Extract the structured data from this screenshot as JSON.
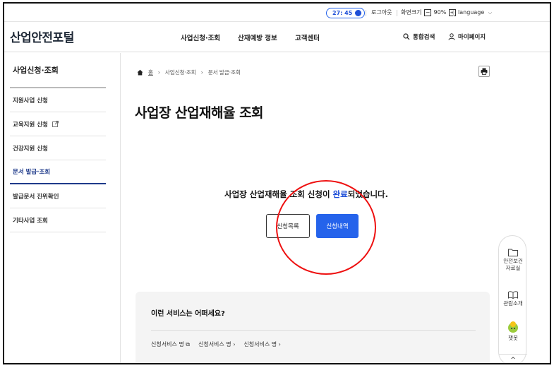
{
  "util": {
    "timer": "27: 45",
    "logout": "로그아웃",
    "zoom_label": "화면크기",
    "zoom_minus": "−",
    "zoom_value": "90%",
    "zoom_plus": "+",
    "language": "language"
  },
  "header": {
    "logo": "산업안전포털",
    "nav": [
      "사업신청·조회",
      "산재예방 정보",
      "고객센터"
    ],
    "search": "통합검색",
    "mypage": "마이페이지"
  },
  "sidebar": {
    "title": "사업신청·조회",
    "items": [
      {
        "label": "지원사업 신청"
      },
      {
        "label": "교육지원 신청"
      },
      {
        "label": "건강지원 신청"
      },
      {
        "label": "문서 발급·조회"
      },
      {
        "label": "발급문서 진위확인"
      },
      {
        "label": "기타사업 조회"
      }
    ]
  },
  "breadcrumb": {
    "home": "홈",
    "level1": "사업신청·조회",
    "level2": "문서 발급·조회"
  },
  "main": {
    "title": "사업장 산업재해율 조회",
    "msg_pre": "사업장 산업재해율 조회 신청이 ",
    "msg_hl": "완료",
    "msg_post": "되었습니다.",
    "btn_list": "신청목록",
    "btn_history": "신청내역"
  },
  "recommend": {
    "title": "이런 서비스는 어떠세요?",
    "links": [
      "신청서비스 명",
      "신청서비스 명",
      "신청서비스 명"
    ]
  },
  "quick": {
    "docs": "안전보건\n자료실",
    "tour": "관람소개",
    "chatbot": "챗봇",
    "up": "^"
  },
  "colors": {
    "accent": "#2563eb",
    "active_nav": "#1e3a8a",
    "annotation": "#e11111"
  }
}
